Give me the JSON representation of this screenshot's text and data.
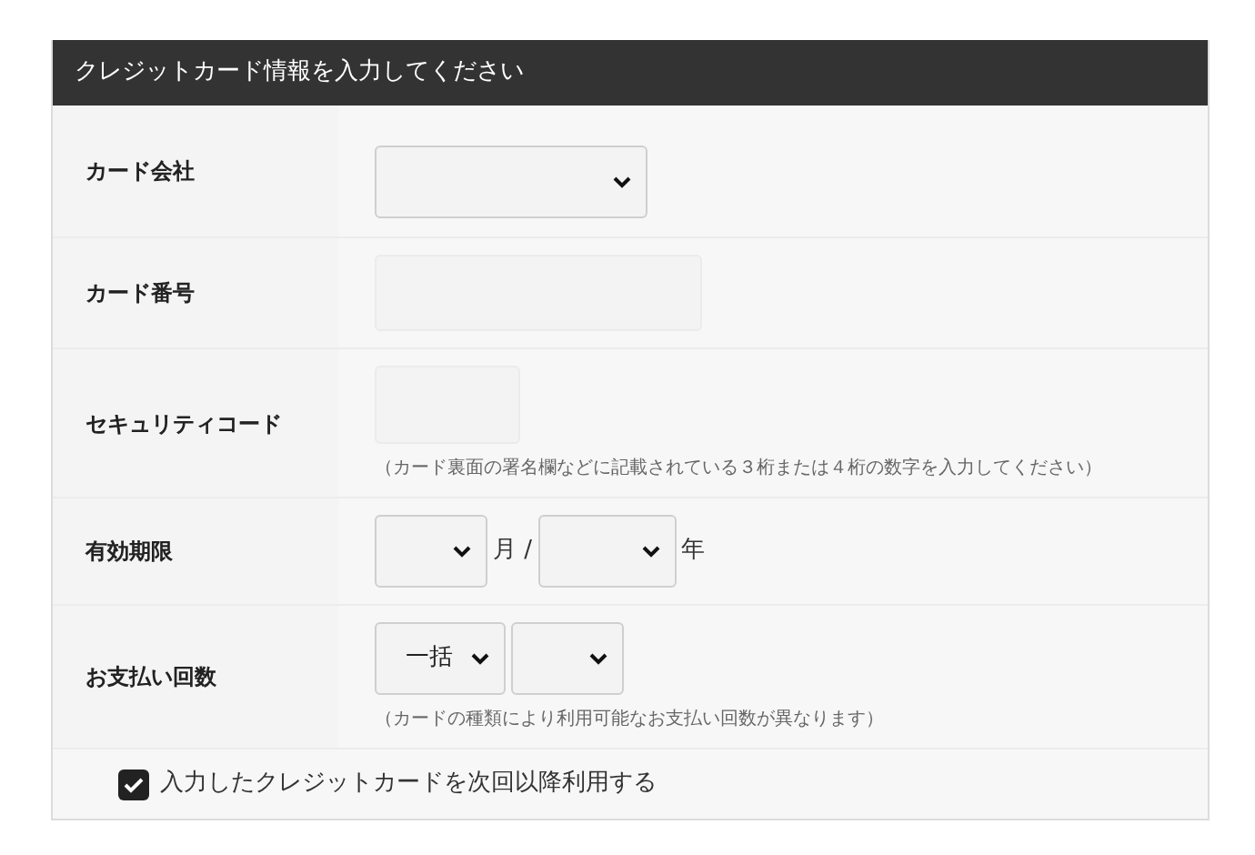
{
  "panel": {
    "title": "クレジットカード情報を入力してください"
  },
  "rows": [
    {
      "label": "カード会社",
      "controls": [
        {
          "kind": "select-company"
        }
      ]
    },
    {
      "label": "カード番号",
      "controls": [
        {
          "kind": "input-number"
        }
      ]
    },
    {
      "label": "セキュリティコード",
      "controls": [
        {
          "kind": "input-code"
        }
      ],
      "note": "（カード裏面の署名欄などに記載されている３桁または４桁の数字を入力してください）"
    },
    {
      "label": "有効期限",
      "controls": [
        {
          "kind": "select-month"
        },
        {
          "kind": "text",
          "text": "月 /"
        },
        {
          "kind": "select-year"
        },
        {
          "kind": "text",
          "text": "年"
        }
      ]
    },
    {
      "label": "お支払い回数",
      "controls": [
        {
          "kind": "select-method",
          "value": "一括"
        },
        {
          "kind": "select-count"
        }
      ],
      "note": "（カードの種類により利用可能なお支払い回数が異なります）"
    }
  ],
  "remember": {
    "label": "入力したクレジットカードを次回以降利用する",
    "checked": true
  }
}
